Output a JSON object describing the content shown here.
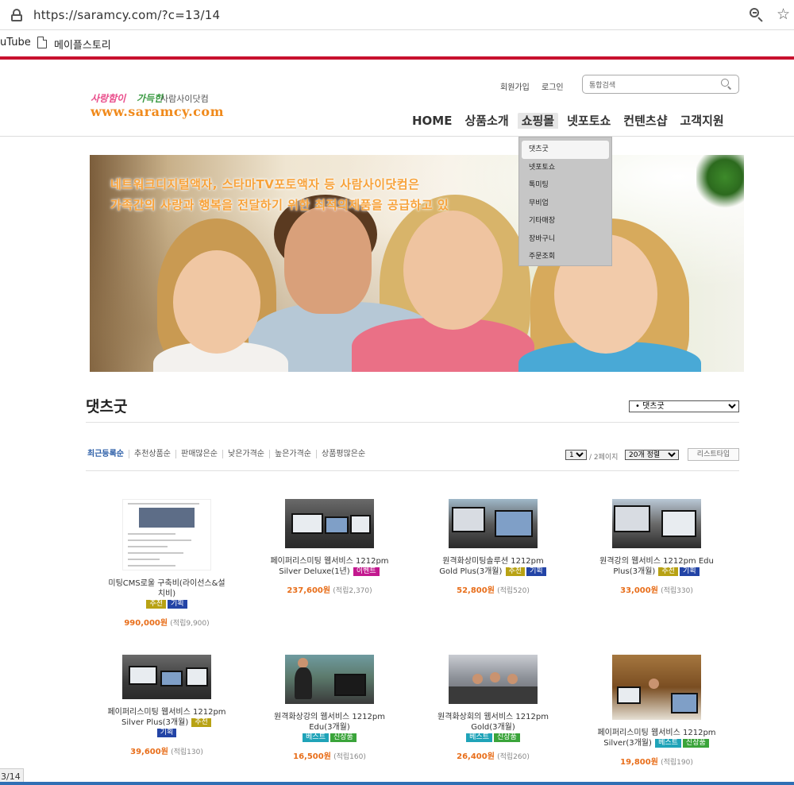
{
  "browser": {
    "url": "https://saramcy.com/?c=13/14",
    "bookmarks": [
      "uTube",
      "메이플스토리"
    ],
    "status_url": "3/14"
  },
  "site": {
    "logo": {
      "tagline_pink": "사랑함이",
      "tagline_green": "가득한",
      "tagline_plain": "사람사이닷컴",
      "domain": "www.saramcy.com"
    },
    "util_links": [
      "회원가입",
      "로그인"
    ],
    "search_placeholder": "통합검색",
    "nav": [
      "HOME",
      "상품소개",
      "쇼핑몰",
      "넷포토쇼",
      "컨텐츠샵",
      "고객지원"
    ],
    "active_nav": "쇼핑몰",
    "dropdown": [
      "댓츠굿",
      "넷포토쇼",
      "톡미팅",
      "무비업",
      "기타매장",
      "장바구니",
      "주문조회"
    ],
    "banner": {
      "line1": "네트워크디지털액자, 스타마TV포토액자 등 사람사이닷컴은",
      "line2": "가족간의 사랑과 행복을 전달하기 위한 최적의제품을 공급하고 있"
    }
  },
  "listing": {
    "title": "댓츠굿",
    "category_select": "• 댓츠굿",
    "sort_options": [
      "최근등록순",
      "추천상품순",
      "판매많은순",
      "낮은가격순",
      "높은가격순",
      "상품평많은순"
    ],
    "page_select": "1",
    "page_info": "/ 2페이지",
    "per_page": "20개 정렬",
    "list_type": "리스트타입"
  },
  "products": [
    {
      "name": "미팅CMS로울 구축비(라이선스&설치비)",
      "badges": [
        {
          "text": "추천",
          "type": "rec"
        },
        {
          "text": "기획",
          "type": "plan"
        }
      ],
      "price": "990,000원",
      "points": "(적립9,900)"
    },
    {
      "name": "페이퍼리스미팅 웹서비스 1212pm Silver Deluxe(1년)",
      "badges": [
        {
          "text": "이벤트",
          "type": "event"
        }
      ],
      "price": "237,600원",
      "points": "(적립2,370)"
    },
    {
      "name": "원격화상미팅솔루션 1212pm Gold Plus(3개월)",
      "badges": [
        {
          "text": "추천",
          "type": "rec"
        },
        {
          "text": "기획",
          "type": "plan"
        }
      ],
      "price": "52,800원",
      "points": "(적립520)"
    },
    {
      "name": "원격강의 웹서비스 1212pm Edu Plus(3개월)",
      "badges": [
        {
          "text": "추천",
          "type": "rec"
        },
        {
          "text": "기획",
          "type": "plan"
        }
      ],
      "price": "33,000원",
      "points": "(적립330)"
    },
    {
      "name": "페이퍼리스미팅 웹서비스 1212pm Silver Plus(3개월)",
      "badges": [
        {
          "text": "추천",
          "type": "rec"
        },
        {
          "text": "기획",
          "type": "plan"
        }
      ],
      "price": "39,600원",
      "points": "(적립130)"
    },
    {
      "name": "원격화상강의 웹서비스 1212pm Edu(3개월)",
      "badges": [
        {
          "text": "베스트",
          "type": "best"
        },
        {
          "text": "신상품",
          "type": "new"
        }
      ],
      "price": "16,500원",
      "points": "(적립160)"
    },
    {
      "name": "원격화상회의 웹서비스 1212pm Gold(3개월)",
      "badges": [
        {
          "text": "베스트",
          "type": "best"
        },
        {
          "text": "신상품",
          "type": "new"
        }
      ],
      "price": "26,400원",
      "points": "(적립260)"
    },
    {
      "name": "페이퍼리스미팅 웹서비스 1212pm Silver(3개월)",
      "badges": [
        {
          "text": "베스트",
          "type": "best"
        },
        {
          "text": "신상품",
          "type": "new"
        }
      ],
      "price": "19,800원",
      "points": "(적립190)"
    }
  ]
}
